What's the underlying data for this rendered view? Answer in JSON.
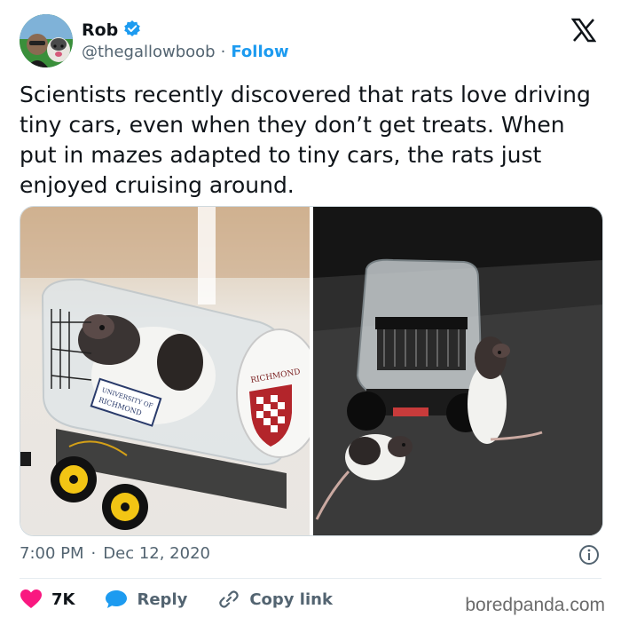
{
  "author": {
    "name": "Rob",
    "handle": "@thegallowboob",
    "separator": "·",
    "follow_label": "Follow",
    "verified": true
  },
  "tweet": {
    "text": "Scientists recently discovered that rats love driving tiny cars, even when they don’t get treats. When put in mazes adapted to tiny cars, the rats just enjoyed cruising around."
  },
  "media": {
    "photo1_alt": "Rat riding in a clear plastic container car",
    "photo2_alt": "Rats standing beside a tiny car",
    "logo_text_top": "RICHMOND",
    "label_text_line1": "UNIVERSITY OF",
    "label_text_line2": "RICHMOND"
  },
  "meta": {
    "time": "7:00 PM",
    "separator": "·",
    "date": "Dec 12, 2020"
  },
  "actions": {
    "likes": "7K",
    "reply_label": "Reply",
    "copy_link_label": "Copy link"
  },
  "watermark": "boredpanda.com",
  "colors": {
    "accent": "#1d9bf0",
    "like": "#f91880",
    "reply": "#1d9bf0",
    "text_secondary": "#536471"
  }
}
